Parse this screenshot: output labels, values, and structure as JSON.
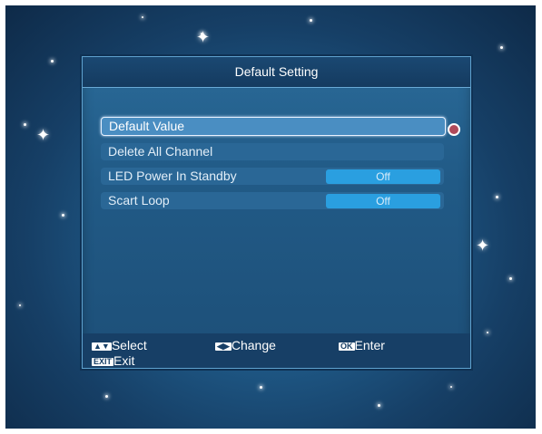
{
  "dialog": {
    "title": "Default Setting",
    "items": [
      {
        "label": "Default Value",
        "value": ""
      },
      {
        "label": "Delete All Channel",
        "value": ""
      },
      {
        "label": "LED Power In Standby",
        "value": "Off"
      },
      {
        "label": "Scart Loop",
        "value": "Off"
      }
    ],
    "selected_index": 0
  },
  "footer": {
    "select": {
      "key": "▲▼",
      "label": "Select"
    },
    "change": {
      "key": "◀▶",
      "label": "Change"
    },
    "enter": {
      "key": "OK",
      "label": "Enter"
    },
    "exit": {
      "key": "EXIT",
      "label": "Exit"
    }
  },
  "colors": {
    "background": "#1f5a88",
    "panel": "#215a86",
    "value_box": "#2a9fe0",
    "text": "#ffffff"
  }
}
